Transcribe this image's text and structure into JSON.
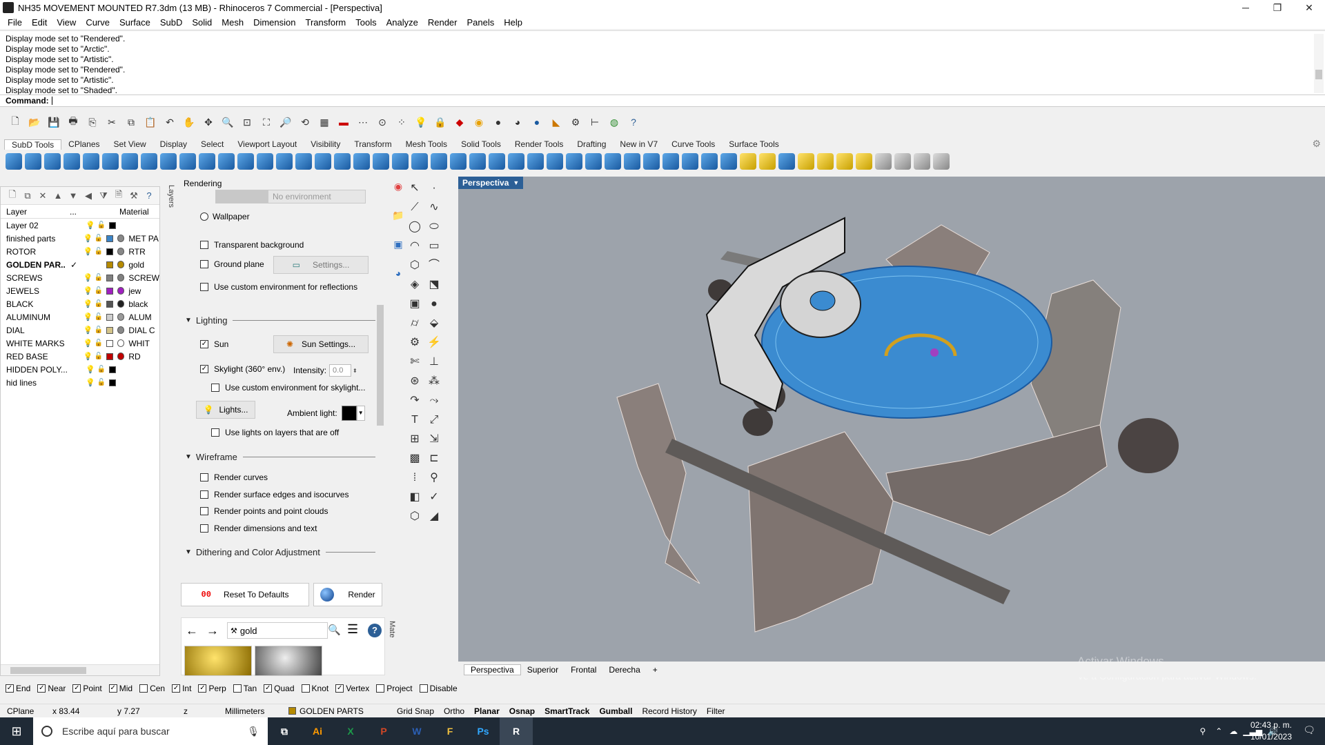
{
  "window": {
    "title": "NH35 MOVEMENT MOUNTED R7.3dm (13 MB) - Rhinoceros 7 Commercial - [Perspectiva]",
    "minimize": "─",
    "maximize": "❐",
    "close": "✕"
  },
  "menu": [
    "File",
    "Edit",
    "View",
    "Curve",
    "Surface",
    "SubD",
    "Solid",
    "Mesh",
    "Dimension",
    "Transform",
    "Tools",
    "Analyze",
    "Render",
    "Panels",
    "Help"
  ],
  "history": [
    "Display mode set to \"Rendered\".",
    "Display mode set to \"Arctic\".",
    "Display mode set to \"Artistic\".",
    "Display mode set to \"Rendered\".",
    "Display mode set to \"Artistic\".",
    "Display mode set to \"Shaded\"."
  ],
  "command": {
    "label": "Command:"
  },
  "toolbar_tabs": [
    "SubD Tools",
    "CPlanes",
    "Set View",
    "Display",
    "Select",
    "Viewport Layout",
    "Visibility",
    "Transform",
    "Render Tools",
    "Drafting",
    "New in V7",
    "Curve Tools",
    "Surface Tools"
  ],
  "toolbar_tabs_extra": [
    "Mesh Tools",
    "Solid Tools"
  ],
  "layers": {
    "headers": {
      "layer": "Layer",
      "dots": "...",
      "material": "Material"
    },
    "rows": [
      {
        "name": "Layer 02",
        "check": "",
        "color": "#000000",
        "mat_color": "",
        "material": "",
        "bulb": "yellow"
      },
      {
        "name": "finished parts",
        "check": "",
        "color": "#3a84c7",
        "mat_color": "#888888",
        "material": "MET PA",
        "bulb": "yellow"
      },
      {
        "name": "ROTOR",
        "check": "",
        "color": "#000000",
        "mat_color": "#888888",
        "material": "RTR",
        "bulb": "yellow"
      },
      {
        "name": "GOLDEN PAR...",
        "check": "✓",
        "color": "#b58a00",
        "mat_color": "#b58a00",
        "material": "gold",
        "bulb": "none",
        "bold": true
      },
      {
        "name": "SCREWS",
        "check": "",
        "color": "#808080",
        "mat_color": "#808080",
        "material": "SCREW",
        "bulb": "yellow"
      },
      {
        "name": "JEWELS",
        "check": "",
        "color": "#a020c0",
        "mat_color": "#a020c0",
        "material": "jew",
        "bulb": "yellow"
      },
      {
        "name": "BLACK",
        "check": "",
        "color": "#555555",
        "mat_color": "#222222",
        "material": "black",
        "bulb": "yellow"
      },
      {
        "name": "ALUMINUM",
        "check": "",
        "color": "#cfcfcf",
        "mat_color": "#9a9a9a",
        "material": "ALUM",
        "bulb": "yellow"
      },
      {
        "name": "DIAL",
        "check": "",
        "color": "#d4c48a",
        "mat_color": "#888888",
        "material": "DIAL C",
        "bulb": "yellow"
      },
      {
        "name": "WHITE MARKS",
        "check": "",
        "color": "#ffffff",
        "mat_color": "#ffffff",
        "material": "WHIT",
        "bulb": "blue"
      },
      {
        "name": "RED BASE",
        "check": "",
        "color": "#c00000",
        "mat_color": "#c00000",
        "material": "RD",
        "bulb": "yellow"
      },
      {
        "name": "HIDDEN POLY...",
        "check": "",
        "color": "#000000",
        "mat_color": "",
        "material": "",
        "bulb": "blue"
      },
      {
        "name": "hid lines",
        "check": "",
        "color": "#000000",
        "mat_color": "",
        "material": "",
        "bulb": "blue"
      }
    ],
    "vtab": "Layers"
  },
  "rendering": {
    "title": "Rendering",
    "environment_placeholder": "No environment",
    "wallpaper": "Wallpaper",
    "transparent_background": "Transparent background",
    "ground_plane": "Ground plane",
    "settings_button": "Settings...",
    "custom_env_reflections": "Use custom environment for reflections",
    "lighting_section": "Lighting",
    "sun": "Sun",
    "sun_settings": "Sun Settings...",
    "skylight": "Skylight (360° env.)",
    "intensity_label": "Intensity:",
    "intensity_value": "0.0",
    "custom_env_skylight": "Use custom environment for skylight...",
    "lights_button": "Lights...",
    "ambient_label": "Ambient light:",
    "ambient_color": "#000000",
    "lights_off_layers": "Use lights on layers that are off",
    "wireframe_section": "Wireframe",
    "render_curves": "Render curves",
    "render_edges": "Render surface edges and isocurves",
    "render_points": "Render points and point clouds",
    "render_dims": "Render dimensions and text",
    "dithering_section": "Dithering and Color Adjustment",
    "reset_button": "Reset To Defaults",
    "render_button": "Render"
  },
  "materials": {
    "search_value": "gold",
    "vtab": "Mate"
  },
  "viewport": {
    "label": "Perspectiva",
    "tabs": [
      "Perspectiva",
      "Superior",
      "Frontal",
      "Derecha"
    ],
    "add_tab": "+",
    "watermark_title": "Activar Windows",
    "watermark_sub": "Ve a Configuración para activar Windows."
  },
  "osnaps": [
    {
      "label": "End",
      "checked": true
    },
    {
      "label": "Near",
      "checked": true
    },
    {
      "label": "Point",
      "checked": true
    },
    {
      "label": "Mid",
      "checked": true
    },
    {
      "label": "Cen",
      "checked": false
    },
    {
      "label": "Int",
      "checked": true
    },
    {
      "label": "Perp",
      "checked": true
    },
    {
      "label": "Tan",
      "checked": false
    },
    {
      "label": "Quad",
      "checked": true
    },
    {
      "label": "Knot",
      "checked": false
    },
    {
      "label": "Vertex",
      "checked": true
    },
    {
      "label": "Project",
      "checked": false
    },
    {
      "label": "Disable",
      "checked": false
    }
  ],
  "status": {
    "cplane": "CPlane",
    "x": "x 83.44",
    "y": "y 7.27",
    "z": "z",
    "units": "Millimeters",
    "layer": "GOLDEN PARTS",
    "layer_color": "#b58a00",
    "toggles": [
      {
        "label": "Grid Snap",
        "bold": false
      },
      {
        "label": "Ortho",
        "bold": false
      },
      {
        "label": "Planar",
        "bold": true
      },
      {
        "label": "Osnap",
        "bold": true
      },
      {
        "label": "SmartTrack",
        "bold": true
      },
      {
        "label": "Gumball",
        "bold": true
      },
      {
        "label": "Record History",
        "bold": false
      },
      {
        "label": "Filter",
        "bold": false
      }
    ]
  },
  "taskbar": {
    "search_placeholder": "Escribe aquí para buscar",
    "time": "02:43 p. m.",
    "date": "10/01/2023",
    "apps": [
      "Ai",
      "X",
      "P",
      "W",
      "F",
      "Ps",
      "R"
    ]
  }
}
